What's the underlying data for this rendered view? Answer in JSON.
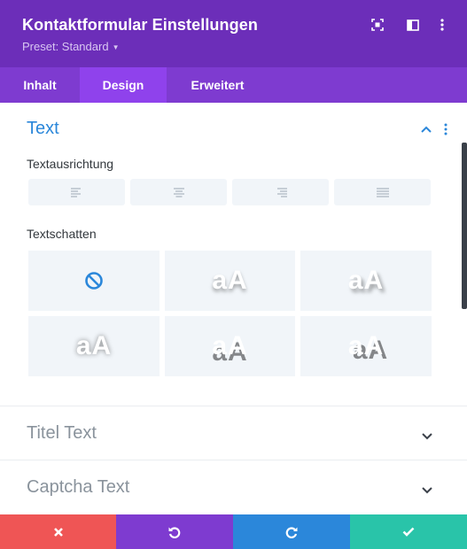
{
  "header": {
    "title": "Kontaktformular Einstellungen",
    "preset": "Preset: Standard",
    "icons": [
      "expand-icon",
      "sidebar-toggle-icon",
      "more-options-icon"
    ]
  },
  "tabs": [
    {
      "label": "Inhalt",
      "active": false
    },
    {
      "label": "Design",
      "active": true
    },
    {
      "label": "Erweitert",
      "active": false
    }
  ],
  "section_text": {
    "title": "Text",
    "text_alignment": {
      "label": "Textausrichtung",
      "options": [
        "align-left-icon",
        "align-center-icon",
        "align-right-icon",
        "align-justify-icon"
      ]
    },
    "text_shadow": {
      "label": "Textschatten",
      "preview_text": "aA",
      "options": [
        "none",
        "shadow-bottom",
        "shadow-bottom-right",
        "shadow-glow",
        "shadow-hard-bottom",
        "shadow-hard-bottom-right"
      ]
    }
  },
  "collapsed_sections": [
    {
      "title": "Titel Text"
    },
    {
      "title": "Captcha Text"
    }
  ],
  "footer": {
    "buttons": [
      "close-icon",
      "undo-icon",
      "redo-icon",
      "check-icon"
    ]
  },
  "colors": {
    "header": "#6c2eb9",
    "tabs": "#7e3bd0",
    "tab_active": "#8f42ec",
    "accent_blue": "#2b87da",
    "cancel": "#ef5555",
    "undo": "#7e3bd0",
    "redo": "#2b87da",
    "save": "#29c4a9"
  }
}
